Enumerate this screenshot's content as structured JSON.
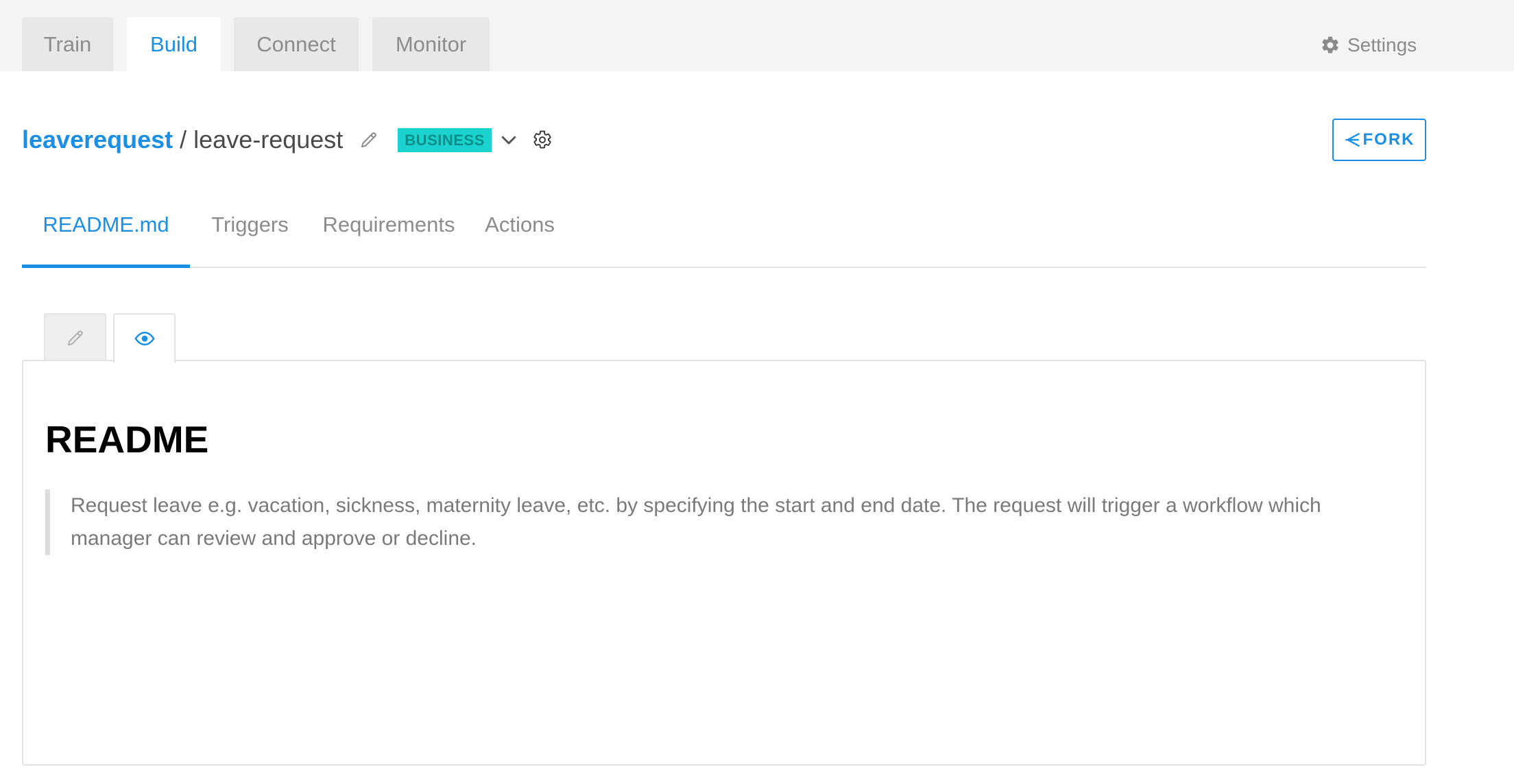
{
  "top_nav": {
    "tabs": [
      {
        "label": "Train"
      },
      {
        "label": "Build",
        "active": true
      },
      {
        "label": "Connect"
      },
      {
        "label": "Monitor"
      }
    ],
    "settings_label": "Settings",
    "settings_icon": "gear-icon"
  },
  "project": {
    "owner": "leaverequest",
    "separator": "/",
    "name": "leave-request",
    "badge": "BUSINESS",
    "fork_label": "FORK"
  },
  "sub_tabs": [
    {
      "label": "README.md",
      "active": true
    },
    {
      "label": "Triggers"
    },
    {
      "label": "Requirements"
    },
    {
      "label": "Actions"
    }
  ],
  "editor_modes": [
    {
      "icon": "pencil-icon",
      "active": false
    },
    {
      "icon": "eye-icon",
      "active": true
    }
  ],
  "readme": {
    "title": "README",
    "quote": "Request leave e.g. vacation, sickness, maternity leave, etc. by specifying the start and end date. The request will trigger a workflow which manager can review and approve or decline."
  },
  "colors": {
    "accent": "#1a8fe3",
    "badge_bg": "#1ad3cf",
    "badge_text": "#0c8e8b",
    "topbar_bg": "#f4f4f4"
  }
}
